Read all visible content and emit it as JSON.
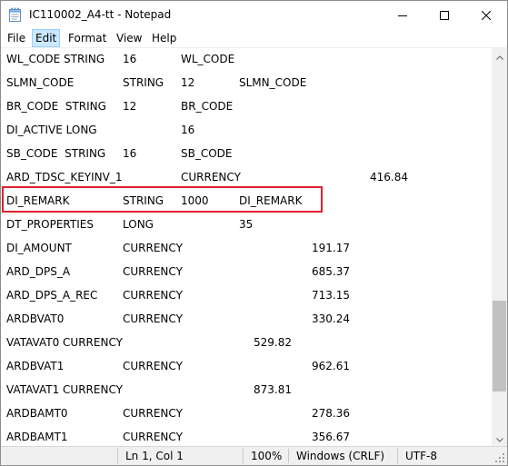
{
  "window": {
    "title": "IC110002_A4-tt - Notepad"
  },
  "icons": {
    "app": "notepad-icon",
    "minimize": "minimize-icon",
    "maximize": "maximize-icon",
    "close": "close-icon"
  },
  "menu": {
    "items": [
      "File",
      "Edit",
      "Format",
      "View",
      "Help"
    ],
    "active": "Edit"
  },
  "editor": {
    "lines": [
      [
        "WL_CODE STRING",
        "16",
        "WL_CODE",
        "",
        ""
      ],
      [
        "SLMN_CODE",
        "STRING",
        "12",
        "SLMN_CODE",
        ""
      ],
      [
        "BR_CODE  STRING",
        "12",
        "BR_CODE",
        "",
        ""
      ],
      [
        "DI_ACTIVE LONG",
        "",
        "16",
        "",
        ""
      ],
      [
        "SB_CODE  STRING",
        "16",
        "SB_CODE",
        "",
        ""
      ],
      [
        "ARD_TDSC_KEYINV_1",
        "",
        "CURRENCY",
        "",
        "416.84"
      ],
      [
        "DI_REMARK",
        "STRING",
        "1000",
        "DI_REMARK",
        ""
      ],
      [
        "DT_PROPERTIES",
        "LONG",
        "",
        "35",
        ""
      ],
      [
        "DI_AMOUNT",
        "CURRENCY",
        "",
        "",
        "191.17"
      ],
      [
        "ARD_DPS_A",
        "CURRENCY",
        "",
        "",
        "685.37"
      ],
      [
        "ARD_DPS_A_REC",
        "CURRENCY",
        "",
        "",
        "713.15"
      ],
      [
        "ARDBVAT0",
        "CURRENCY",
        "",
        "",
        "330.24"
      ],
      [
        "VATAVAT0 CURRENCY",
        "",
        "",
        "529.82",
        ""
      ],
      [
        "ARDBVAT1",
        "CURRENCY",
        "",
        "",
        "962.61"
      ],
      [
        "VATAVAT1 CURRENCY",
        "",
        "",
        "873.81",
        ""
      ],
      [
        "ARDBAMT0",
        "CURRENCY",
        "",
        "",
        "278.36"
      ],
      [
        "ARDBAMT1",
        "CURRENCY",
        "",
        "",
        "356.67"
      ]
    ],
    "highlighted_line": 6
  },
  "status": {
    "position": "Ln 1, Col 1",
    "zoom": "100%",
    "line_ending": "Windows (CRLF)",
    "encoding": "UTF-8"
  },
  "colors": {
    "highlight_border": "#e0212e",
    "menu_active_bg": "#cce8ff"
  }
}
